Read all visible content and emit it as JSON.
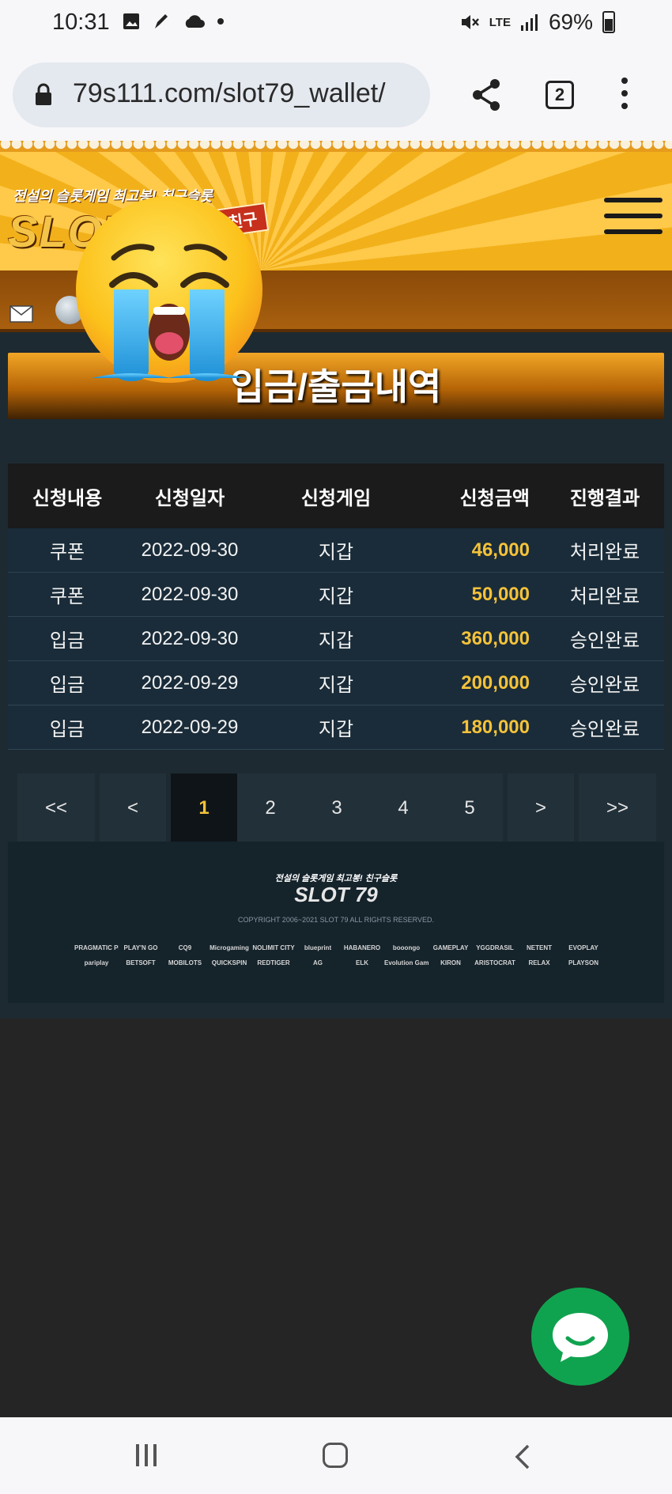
{
  "status_bar": {
    "time": "10:31",
    "battery": "69%",
    "network": "LTE"
  },
  "browser": {
    "url": "79s111.com/slot79_wallet/",
    "tab_count": "2"
  },
  "site": {
    "tagline": "전설의 슬롯게임 최고봉! 친구슬롯",
    "logo": "SLOT",
    "logo_badge": "친구",
    "page_title": "입금/출금내역"
  },
  "table": {
    "headers": [
      "신청내용",
      "신청일자",
      "신청게임",
      "신청금액",
      "진행결과"
    ],
    "rows": [
      [
        "쿠폰",
        "2022-09-30",
        "지갑",
        "46,000",
        "처리완료"
      ],
      [
        "쿠폰",
        "2022-09-30",
        "지갑",
        "50,000",
        "처리완료"
      ],
      [
        "입금",
        "2022-09-30",
        "지갑",
        "360,000",
        "승인완료"
      ],
      [
        "입금",
        "2022-09-29",
        "지갑",
        "200,000",
        "승인완료"
      ],
      [
        "입금",
        "2022-09-29",
        "지갑",
        "180,000",
        "승인완료"
      ]
    ]
  },
  "pagination": {
    "first": "<<",
    "prev": "<",
    "pages": [
      "1",
      "2",
      "3",
      "4",
      "5"
    ],
    "current": "1",
    "next": ">",
    "last": ">>"
  },
  "footer": {
    "tagline": "전설의 슬롯게임 최고봉! 친구슬롯",
    "logo": "SLOT 79",
    "copyright": "COPYRIGHT 2006~2021 SLOT 79 ALL RIGHTS RESERVED.",
    "providers": [
      "PRAGMATIC PLAY",
      "PLAY'N GO",
      "CQ9",
      "Microgaming",
      "NOLIMIT CITY",
      "blueprint",
      "HABANERO",
      "booongo",
      "GAMEPLAY",
      "YGGDRASIL",
      "NETENT",
      "EVOPLAY",
      "pariplay",
      "BETSOFT",
      "MOBILOTS",
      "QUICKSPIN",
      "REDTIGER",
      "AG",
      "ELK",
      "Evolution Gaming",
      "KIRON",
      "ARISTOCRAT",
      "RELAX",
      "PLAYSON"
    ]
  },
  "colors": {
    "amount": "#f4c23a",
    "active_page": "#f3c23a",
    "chat": "#10a34f"
  }
}
